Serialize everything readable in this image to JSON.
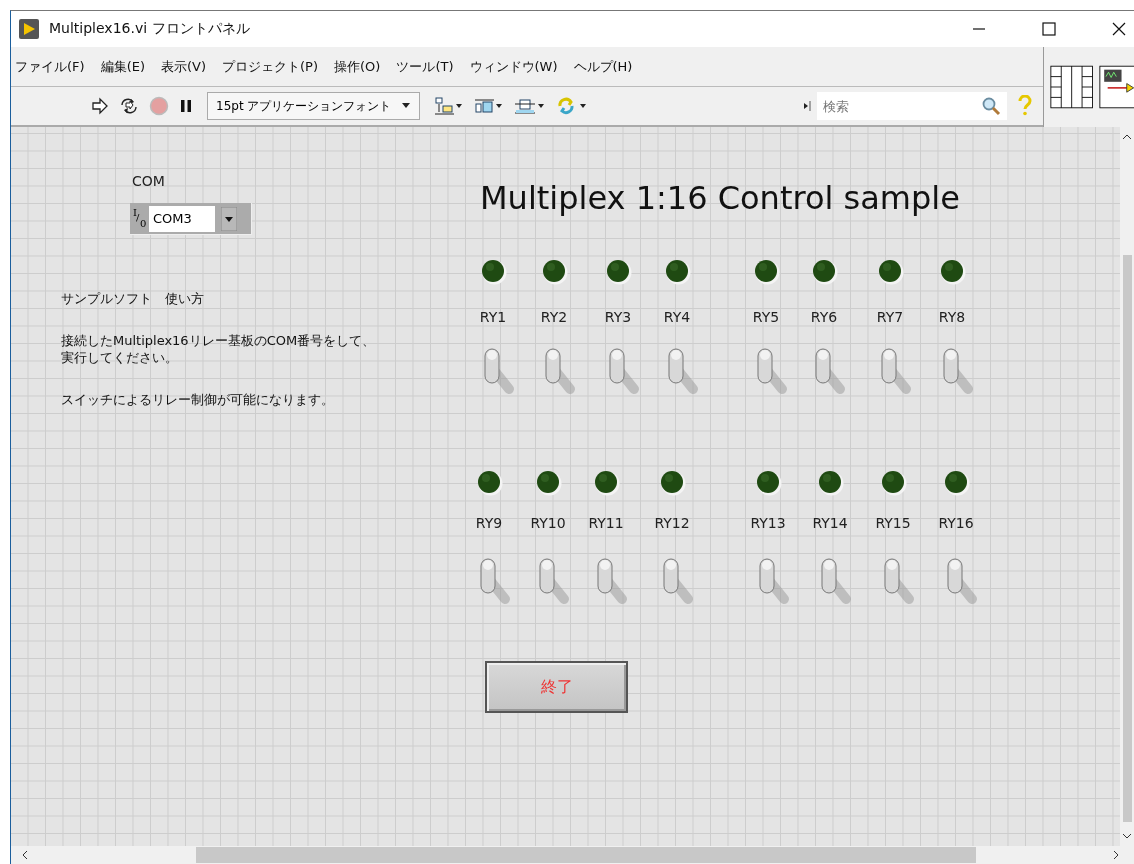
{
  "window": {
    "title": "Multiplex16.vi フロントパネル"
  },
  "menu": [
    "ファイル(F)",
    "編集(E)",
    "表示(V)",
    "プロジェクト(P)",
    "操作(O)",
    "ツール(T)",
    "ウィンドウ(W)",
    "ヘルプ(H)"
  ],
  "toolbar": {
    "font_selector": "15pt アプリケーションフォント",
    "search": {
      "placeholder": "検索"
    }
  },
  "panel": {
    "title": "Multiplex 1:16 Control sample",
    "com_control": {
      "label": "COM",
      "prefix": [
        "I",
        "/",
        "0"
      ],
      "value": "COM3"
    },
    "instructions": [
      [
        "サンプルソフト　使い方"
      ],
      [
        "接続したMultiplex16リレー基板のCOM番号をして、",
        "実行してください。"
      ],
      [
        "スイッチによるリレー制御が可能になります。"
      ]
    ],
    "relays": [
      {
        "label": "RY1",
        "led_on": false,
        "switch_on": false
      },
      {
        "label": "RY2",
        "led_on": false,
        "switch_on": false
      },
      {
        "label": "RY3",
        "led_on": false,
        "switch_on": false
      },
      {
        "label": "RY4",
        "led_on": false,
        "switch_on": false
      },
      {
        "label": "RY5",
        "led_on": false,
        "switch_on": false
      },
      {
        "label": "RY6",
        "led_on": false,
        "switch_on": false
      },
      {
        "label": "RY7",
        "led_on": false,
        "switch_on": false
      },
      {
        "label": "RY8",
        "led_on": false,
        "switch_on": false
      },
      {
        "label": "RY9",
        "led_on": false,
        "switch_on": false
      },
      {
        "label": "RY10",
        "led_on": false,
        "switch_on": false
      },
      {
        "label": "RY11",
        "led_on": false,
        "switch_on": false
      },
      {
        "label": "RY12",
        "led_on": false,
        "switch_on": false
      },
      {
        "label": "RY13",
        "led_on": false,
        "switch_on": false
      },
      {
        "label": "RY14",
        "led_on": false,
        "switch_on": false
      },
      {
        "label": "RY15",
        "led_on": false,
        "switch_on": false
      },
      {
        "label": "RY16",
        "led_on": false,
        "switch_on": false
      }
    ],
    "stop_button": "終了"
  }
}
